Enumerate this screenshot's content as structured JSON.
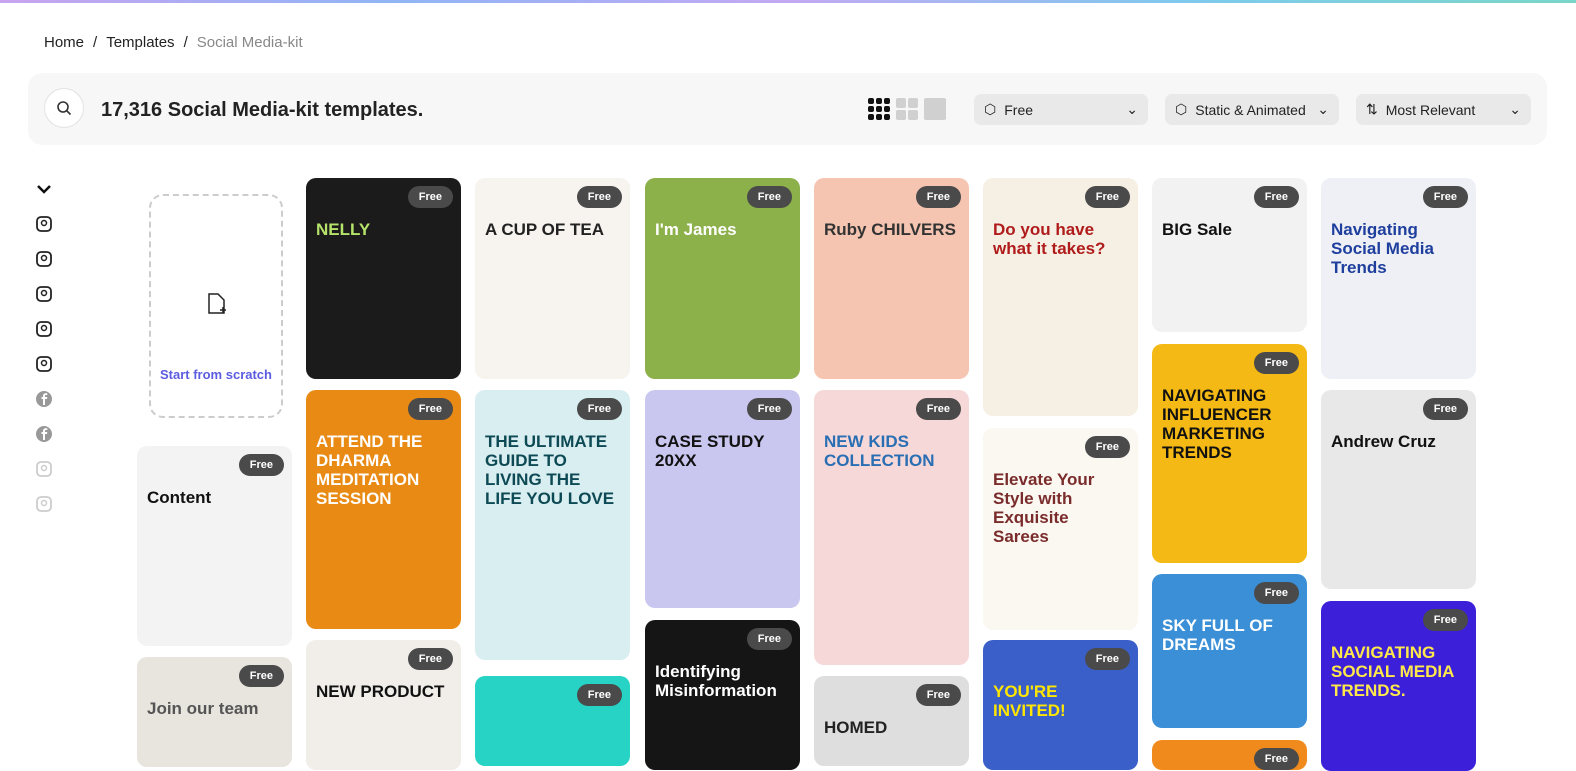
{
  "breadcrumb": [
    "Home",
    "Templates",
    "Social Media-kit"
  ],
  "header": {
    "title": "17,316 Social Media-kit templates."
  },
  "filters": [
    {
      "label": "Free",
      "icon": "premium-icon"
    },
    {
      "label": "Static & Animated",
      "icon": "animation-icon"
    },
    {
      "label": "Most Relevant",
      "icon": "sort-icon"
    }
  ],
  "views": [
    "grid-small-icon",
    "grid-medium-icon",
    "grid-large-icon"
  ],
  "sidebar": [
    "chevron-down-icon",
    "template-search-icon",
    "premium-icon",
    "banner-icon",
    "story-icon",
    "photo-post-icon",
    "facebook-icon",
    "facebook-icon",
    "profile-icon",
    "photo-icon"
  ],
  "scratch": {
    "label": "Start from scratch"
  },
  "badge": "Free",
  "cards": [
    {
      "text": "Content",
      "bg": "#f3f3f3",
      "fg": "#111"
    },
    {
      "text": "Join our team",
      "bg": "#e8e4de",
      "fg": "#555"
    },
    {
      "text": "NELLY",
      "bg": "#1b1b1b",
      "fg": "#b6e36a"
    },
    {
      "text": "ATTEND THE DHARMA MEDITATION SESSION",
      "bg": "#e98a14",
      "fg": "#fff"
    },
    {
      "text": "NEW PRODUCT",
      "bg": "#f1ede8",
      "fg": "#111"
    },
    {
      "text": "A CUP OF TEA",
      "bg": "#f7f3ef",
      "fg": "#222"
    },
    {
      "text": "THE ULTIMATE GUIDE TO LIVING THE LIFE YOU LOVE",
      "bg": "#d8eef0",
      "fg": "#0d4a55"
    },
    {
      "text": "",
      "bg": "#27d3c4",
      "fg": "#111"
    },
    {
      "text": "I'm James",
      "bg": "#8cb04a",
      "fg": "#fff"
    },
    {
      "text": "CASE STUDY 20XX",
      "bg": "#c9c7f0",
      "fg": "#111"
    },
    {
      "text": "Identifying Misinformation",
      "bg": "#151515",
      "fg": "#fff"
    },
    {
      "text": "Ruby CHILVERS",
      "bg": "#f6c5b2",
      "fg": "#333"
    },
    {
      "text": "NEW KIDS COLLECTION",
      "bg": "#f7d8d8",
      "fg": "#2a6fb3"
    },
    {
      "text": "HOMED",
      "bg": "#dedede",
      "fg": "#222"
    },
    {
      "text": "Do you have what it takes?",
      "bg": "#f6efe3",
      "fg": "#b01c1c"
    },
    {
      "text": "Elevate Your Style with Exquisite Sarees",
      "bg": "#fbf8f2",
      "fg": "#7a2b2b"
    },
    {
      "text": "YOU'RE INVITED!",
      "bg": "#3a5fc9",
      "fg": "#ffe600"
    },
    {
      "text": "BIG Sale",
      "bg": "#f2f2f2",
      "fg": "#111"
    },
    {
      "text": "NAVIGATING INFLUENCER MARKETING TRENDS",
      "bg": "#f4b914",
      "fg": "#111"
    },
    {
      "text": "SKY FULL OF DREAMS",
      "bg": "#3b8fd6",
      "fg": "#fff"
    },
    {
      "text": "",
      "bg": "#f08a1c",
      "fg": "#fff"
    },
    {
      "text": "Navigating Social Media Trends",
      "bg": "#eef0f5",
      "fg": "#1f3f9e"
    },
    {
      "text": "Andrew Cruz",
      "bg": "#e8e8e8",
      "fg": "#111"
    },
    {
      "text": "NAVIGATING SOCIAL MEDIA TRENDS.",
      "bg": "#3b1fd9",
      "fg": "#ffe94a"
    }
  ]
}
